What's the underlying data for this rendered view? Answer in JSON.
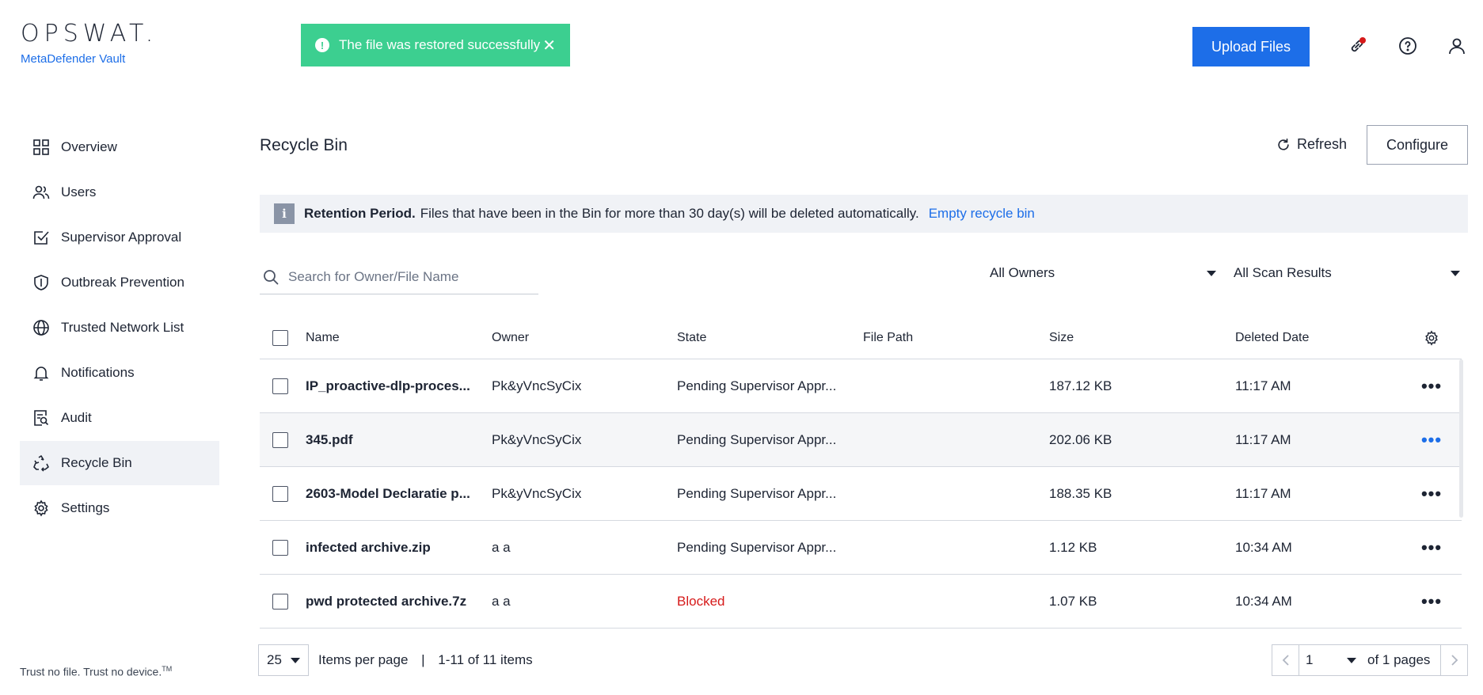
{
  "brand": {
    "logo": "OPSWAT.",
    "product": "MetaDefender Vault"
  },
  "toast": {
    "message": "The file was restored successfully",
    "close": "✕"
  },
  "header": {
    "upload_label": "Upload Files"
  },
  "sidebar": {
    "items": [
      {
        "label": "Overview",
        "icon": "grid-icon"
      },
      {
        "label": "Users",
        "icon": "users-icon"
      },
      {
        "label": "Supervisor Approval",
        "icon": "checkbox-icon"
      },
      {
        "label": "Outbreak Prevention",
        "icon": "shield-icon"
      },
      {
        "label": "Trusted Network List",
        "icon": "globe-icon"
      },
      {
        "label": "Notifications",
        "icon": "bell-icon"
      },
      {
        "label": "Audit",
        "icon": "audit-icon"
      },
      {
        "label": "Recycle Bin",
        "icon": "recycle-icon"
      },
      {
        "label": "Settings",
        "icon": "gear-icon"
      }
    ],
    "active": "Recycle Bin",
    "tagline": "Trust no file. Trust no device.",
    "tagline_tm": "TM"
  },
  "main": {
    "title": "Recycle Bin",
    "refresh_label": "Refresh",
    "configure_label": "Configure",
    "banner": {
      "bold": "Retention Period.",
      "text": "Files that have been in the Bin for more than 30 day(s) will be deleted automatically.",
      "link": "Empty recycle bin"
    },
    "search_placeholder": "Search for Owner/File Name",
    "owner_filter": "All Owners",
    "scan_filter": "All Scan Results"
  },
  "table": {
    "columns": [
      "Name",
      "Owner",
      "State",
      "File Path",
      "Size",
      "Deleted Date"
    ],
    "rows": [
      {
        "name": "IP_proactive-dlp-proces...",
        "owner": "Pk&yVncSyCix",
        "state": "Pending Supervisor Appr...",
        "path": "",
        "size": "187.12 KB",
        "date": "11:17 AM"
      },
      {
        "name": "345.pdf",
        "owner": "Pk&yVncSyCix",
        "state": "Pending Supervisor Appr...",
        "path": "",
        "size": "202.06 KB",
        "date": "11:17 AM"
      },
      {
        "name": "2603-Model Declaratie p...",
        "owner": "Pk&yVncSyCix",
        "state": "Pending Supervisor Appr...",
        "path": "",
        "size": "188.35 KB",
        "date": "11:17 AM"
      },
      {
        "name": "infected archive.zip",
        "owner": "a a",
        "state": "Pending Supervisor Appr...",
        "path": "",
        "size": "1.12 KB",
        "date": "10:34 AM"
      },
      {
        "name": "pwd protected archive.7z",
        "owner": "a a",
        "state": "Blocked",
        "path": "",
        "size": "1.07 KB",
        "date": "10:34 AM"
      }
    ]
  },
  "pagination": {
    "per_page": "25",
    "per_page_label": "Items per page",
    "range": "1-11 of 11 items",
    "page": "1",
    "of_pages": "of 1 pages"
  },
  "colors": {
    "accent": "#1d6ee8",
    "toast": "#3ccf90",
    "blocked": "#d61a1a"
  }
}
